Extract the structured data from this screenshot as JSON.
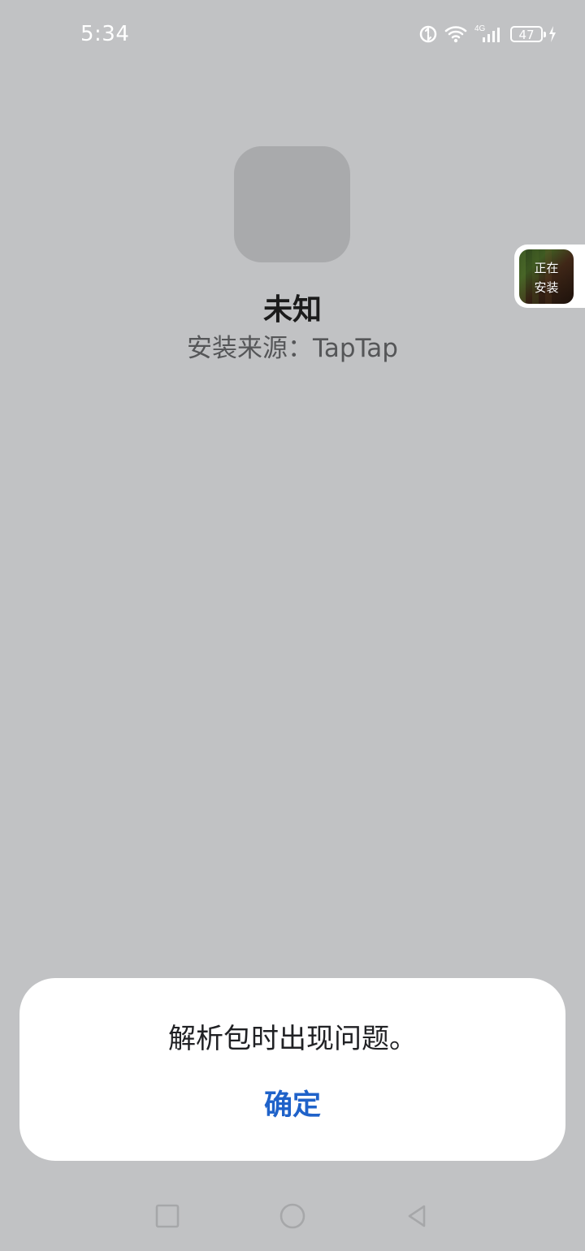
{
  "status_bar": {
    "time": "5:34",
    "battery_level": "47",
    "network_label": "4G",
    "icons": [
      "sync-icon",
      "wifi-icon",
      "signal-icon",
      "battery-icon",
      "charging-icon"
    ]
  },
  "app": {
    "name": "未知",
    "install_source": "安装来源：TapTap"
  },
  "floating_install": {
    "line1": "正在",
    "line2": "安装"
  },
  "dialog": {
    "message": "解析包时出现问题。",
    "confirm_label": "确定"
  },
  "navigation": {
    "icons": [
      "recents-icon",
      "home-icon",
      "back-icon"
    ]
  },
  "colors": {
    "background": "#c1c2c4",
    "dialog": "#ffffff",
    "accent": "#1f62c9",
    "text_primary": "#1b1b1b",
    "text_secondary": "#555658",
    "icon_placeholder": "#a9aaac"
  }
}
